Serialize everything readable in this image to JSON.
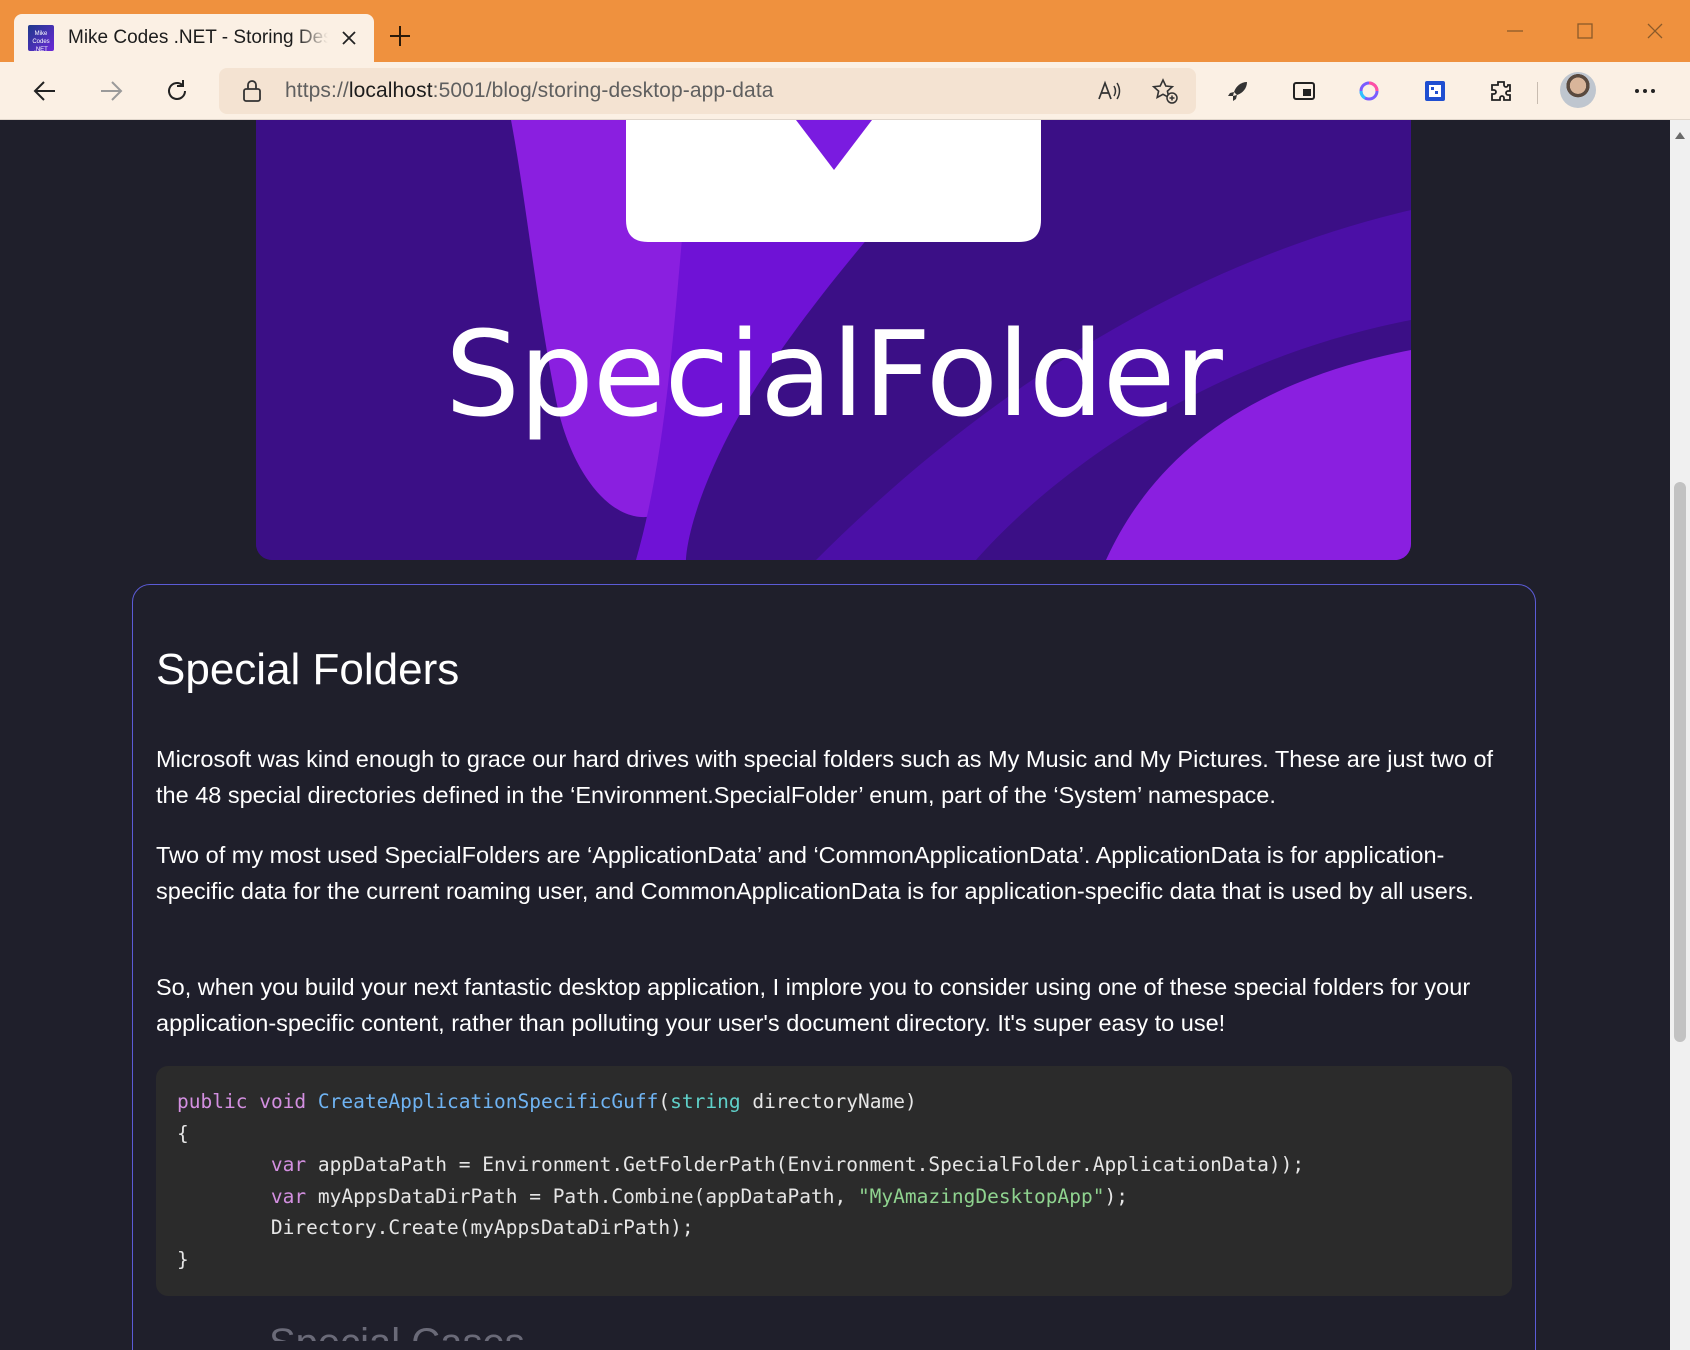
{
  "browser": {
    "tab": {
      "favicon_text": "Mike Codes .NET",
      "title": "Mike Codes .NET - Storing Desktop App Data"
    },
    "url": {
      "scheme": "https://",
      "host": "localhost",
      "rest": ":5001/blog/storing-desktop-app-data"
    },
    "icons": [
      "back-icon",
      "forward-icon",
      "refresh-icon",
      "lock-icon",
      "read-aloud-icon",
      "add-favorite-icon",
      "rocket-icon",
      "split-screen-icon",
      "copilot-icon",
      "extension-icon",
      "extensions-icon",
      "profile-avatar",
      "more-icon"
    ]
  },
  "hero": {
    "text": "SpecialFolder",
    "colors": {
      "bg": "#3b0f86",
      "accent": "#8a1fe0",
      "accent2": "#6f12d6"
    }
  },
  "article": {
    "heading": "Special Folders",
    "paragraphs": [
      "Microsoft was kind enough to grace our hard drives with special folders such as My Music and My Pictures. These are just two of the 48 special directories defined in the ‘Environment.SpecialFolder’ enum, part of the ‘System’ namespace.",
      "Two of my most used SpecialFolders are ‘ApplicationData’ and ‘CommonApplicationData’. ApplicationData is for application-specific data for the current roaming user, and CommonApplicationData is for application-specific data that is used by all users.",
      "So, when you build your next fantastic desktop application, I implore you to consider using one of these special folders for your application-specific content, rather than polluting your user's document directory. It's super easy to use!"
    ],
    "code": {
      "line1": {
        "kw1": "public",
        "kw2": "void",
        "fn": "CreateApplicationSpecificGuff",
        "open": "(",
        "type": "string",
        "rest": " directoryName)"
      },
      "line2": "{",
      "line3": {
        "kw": "var",
        "rest": " appDataPath = Environment.GetFolderPath(Environment.SpecialFolder.ApplicationData));"
      },
      "line4": {
        "kw": "var",
        "mid": " myAppsDataDirPath = Path.Combine(appDataPath, ",
        "str": "\"MyAmazingDesktopApp\"",
        "end": ");"
      },
      "line5": "Directory.Create(myAppsDataDirPath);",
      "line6": "}"
    },
    "next_heading_partial": "Special Cases"
  }
}
